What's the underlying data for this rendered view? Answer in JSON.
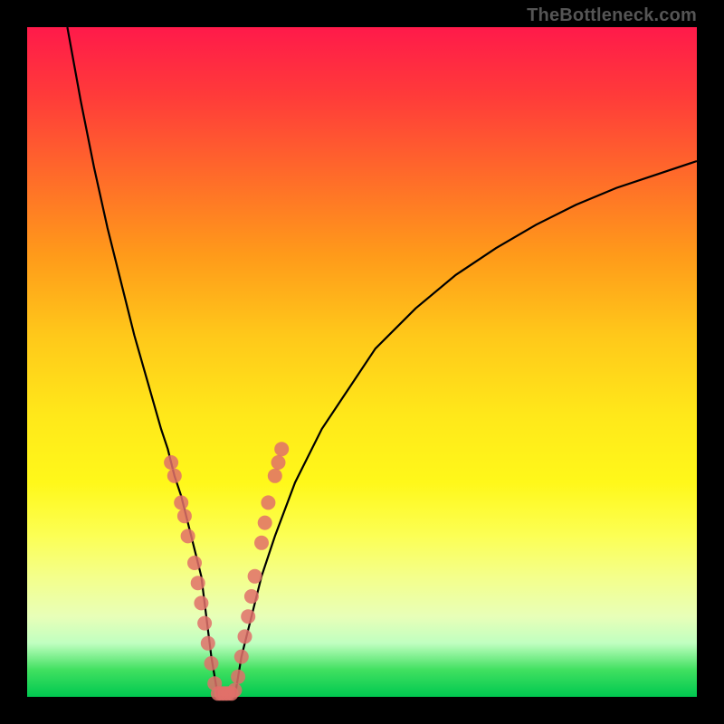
{
  "watermark": "TheBottleneck.com",
  "chart_data": {
    "type": "line",
    "title": "",
    "xlabel": "",
    "ylabel": "",
    "xlim": [
      0,
      100
    ],
    "ylim": [
      0,
      100
    ],
    "background_gradient": {
      "stops": [
        {
          "pos": 0,
          "color": "#ff1a4a"
        },
        {
          "pos": 50,
          "color": "#ffe81a"
        },
        {
          "pos": 92,
          "color": "#c0ffc0"
        },
        {
          "pos": 100,
          "color": "#00c850"
        }
      ]
    },
    "series": [
      {
        "name": "left-curve",
        "x": [
          6,
          8,
          10,
          12,
          14,
          16,
          18,
          20,
          21,
          22,
          23,
          24,
          25,
          26,
          26.5,
          27,
          27.5,
          28,
          28.5
        ],
        "y": [
          100,
          89,
          79,
          70,
          62,
          54,
          47,
          40,
          37,
          33,
          30,
          26,
          22,
          18,
          14,
          10,
          6,
          3,
          0
        ]
      },
      {
        "name": "right-curve",
        "x": [
          31,
          31.5,
          32,
          33,
          34,
          35,
          37,
          40,
          44,
          48,
          52,
          58,
          64,
          70,
          76,
          82,
          88,
          94,
          100
        ],
        "y": [
          0,
          3,
          6,
          10,
          14,
          18,
          24,
          32,
          40,
          46,
          52,
          58,
          63,
          67,
          70.5,
          73.5,
          76,
          78,
          80
        ]
      },
      {
        "name": "valley-floor",
        "x": [
          28.5,
          29,
          29.5,
          30,
          30.5,
          31
        ],
        "y": [
          0,
          0,
          0,
          0,
          0,
          0
        ]
      }
    ],
    "scatter": {
      "name": "data-points",
      "points": [
        {
          "x": 21.5,
          "y": 35
        },
        {
          "x": 22,
          "y": 33
        },
        {
          "x": 23,
          "y": 29
        },
        {
          "x": 23.5,
          "y": 27
        },
        {
          "x": 24,
          "y": 24
        },
        {
          "x": 25,
          "y": 20
        },
        {
          "x": 25.5,
          "y": 17
        },
        {
          "x": 26,
          "y": 14
        },
        {
          "x": 26.5,
          "y": 11
        },
        {
          "x": 27,
          "y": 8
        },
        {
          "x": 27.5,
          "y": 5
        },
        {
          "x": 28,
          "y": 2
        },
        {
          "x": 28.5,
          "y": 0.5
        },
        {
          "x": 29,
          "y": 0.5
        },
        {
          "x": 29.5,
          "y": 0.5
        },
        {
          "x": 30,
          "y": 0.5
        },
        {
          "x": 30.5,
          "y": 0.5
        },
        {
          "x": 31,
          "y": 1
        },
        {
          "x": 31.5,
          "y": 3
        },
        {
          "x": 32,
          "y": 6
        },
        {
          "x": 32.5,
          "y": 9
        },
        {
          "x": 33,
          "y": 12
        },
        {
          "x": 33.5,
          "y": 15
        },
        {
          "x": 34,
          "y": 18
        },
        {
          "x": 35,
          "y": 23
        },
        {
          "x": 35.5,
          "y": 26
        },
        {
          "x": 36,
          "y": 29
        },
        {
          "x": 37,
          "y": 33
        },
        {
          "x": 37.5,
          "y": 35
        },
        {
          "x": 38,
          "y": 37
        }
      ]
    }
  }
}
